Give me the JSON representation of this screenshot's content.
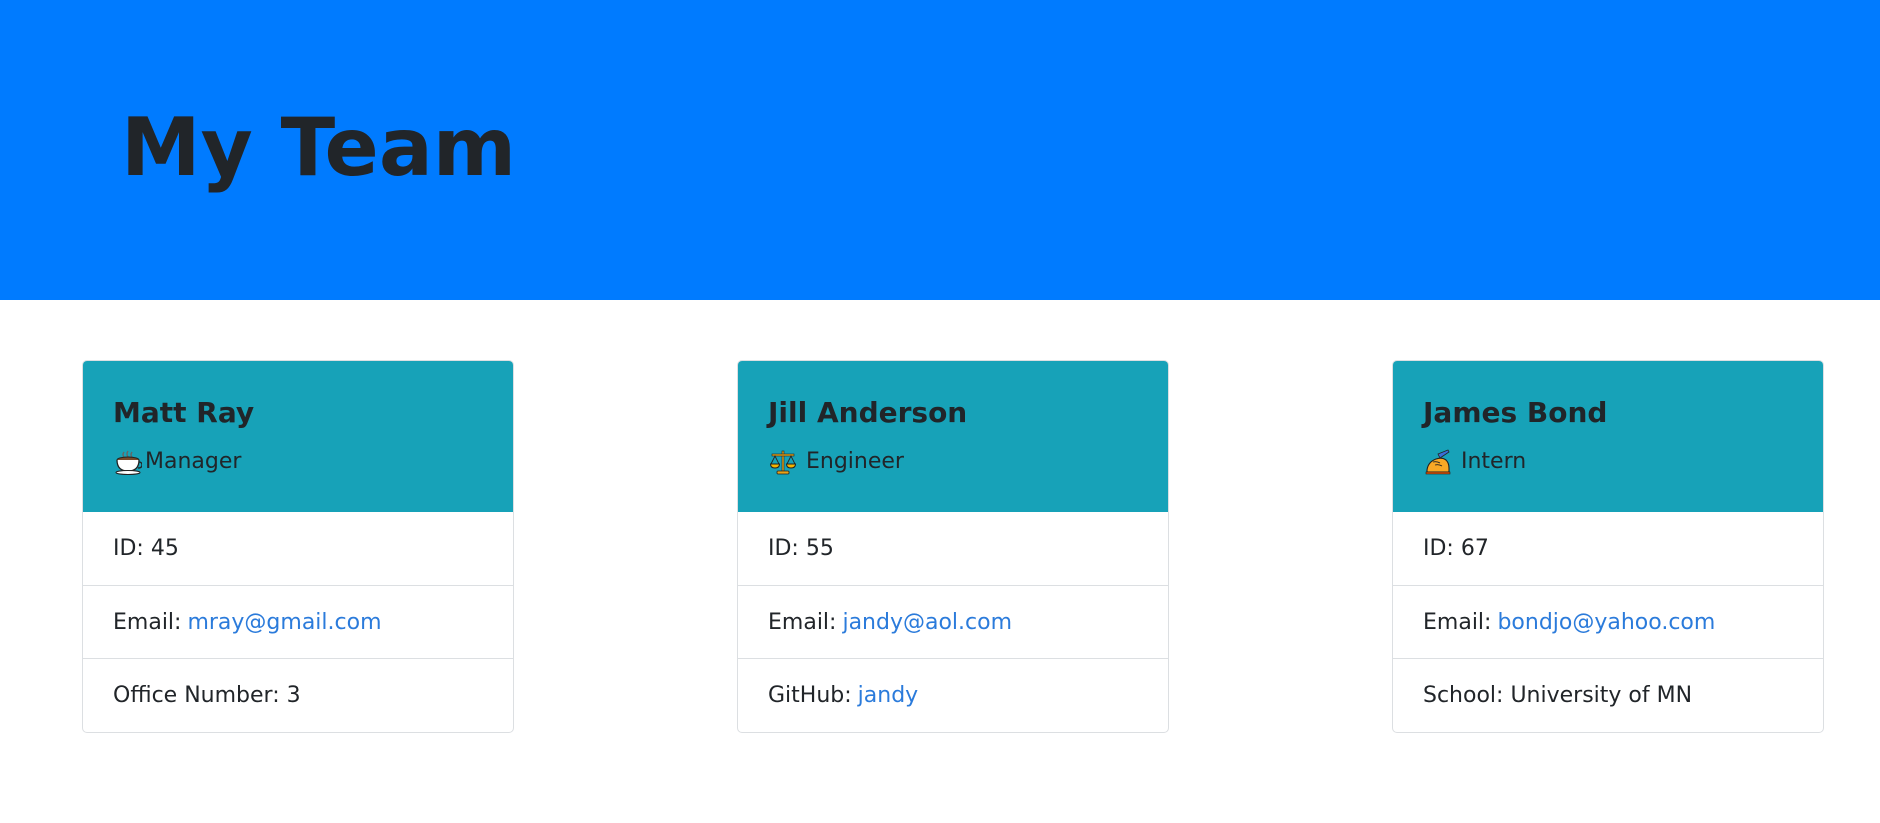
{
  "header": {
    "title": "My Team"
  },
  "colors": {
    "jumbotron": "#007bff",
    "card_header": "#17a2b8",
    "link": "#2b7bdb",
    "text": "#212529"
  },
  "cards": [
    {
      "name": "Matt Ray",
      "role": "Manager",
      "icon": "coffee-icon",
      "id_label": "ID: 45",
      "email_label": "Email:",
      "email": "mray@gmail.com",
      "extra_label": "Office Number: 3",
      "extra_link": ""
    },
    {
      "name": "Jill Anderson",
      "role": "Engineer",
      "icon": "scales-icon",
      "id_label": "ID: 55",
      "email_label": "Email:",
      "email": "jandy@aol.com",
      "extra_label": "GitHub:",
      "extra_link": "jandy"
    },
    {
      "name": "James Bond",
      "role": "Intern",
      "icon": "writing-hand-icon",
      "id_label": "ID: 67",
      "email_label": "Email:",
      "email": "bondjo@yahoo.com",
      "extra_label": "School: University of MN",
      "extra_link": ""
    }
  ]
}
